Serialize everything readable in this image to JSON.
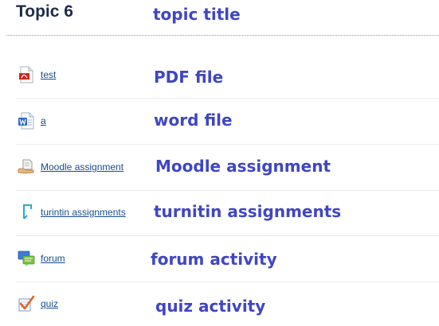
{
  "section": {
    "heading": "Topic 6",
    "heading_note": "topic title"
  },
  "items": [
    {
      "label": "test",
      "icon": "pdf-icon",
      "note": "PDF file"
    },
    {
      "label": "a",
      "icon": "word-document-icon",
      "note": "word file"
    },
    {
      "label": "Moodle assignment",
      "icon": "assignment-icon",
      "note": "Moodle assignment"
    },
    {
      "label": "turintin assignments",
      "icon": "turnitin-icon",
      "note": "turnitin assignments"
    },
    {
      "label": "forum",
      "icon": "forum-icon",
      "note": "forum activity"
    },
    {
      "label": "quiz",
      "icon": "quiz-icon",
      "note": "quiz activity"
    }
  ],
  "colors": {
    "annotation": "#3f46c4",
    "heading": "#1d2a4a",
    "link": "#1a4c8c"
  }
}
